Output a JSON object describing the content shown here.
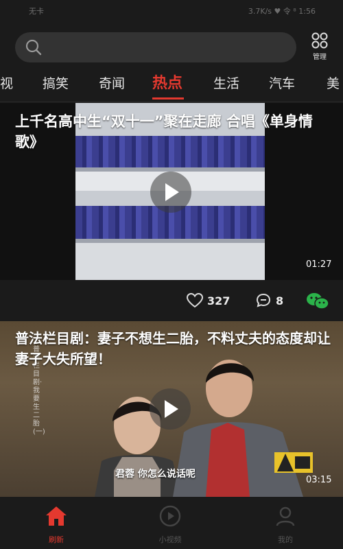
{
  "status_bar": {
    "left": "无卡",
    "right": "3.7K/s ♥ 令 ⁸ 1:56"
  },
  "search": {
    "placeholder": ""
  },
  "manage": {
    "label": "管理"
  },
  "tabs": [
    "视",
    "搞笑",
    "奇闻",
    "热点",
    "生活",
    "汽车",
    "美"
  ],
  "active_tab": "热点",
  "feed": [
    {
      "title": "上千名高中生“双十一”聚在走廊 合唱《单身情歌》",
      "duration": "01:27",
      "likes": "327",
      "comments": "8"
    },
    {
      "title": "普法栏目剧：妻子不想生二胎，不料丈夫的态度却让妻子大失所望！",
      "duration": "03:15",
      "subtitle": "君蓉 你怎么说话呢",
      "side_text": "普法栏目剧·我要生二胎(一)"
    }
  ],
  "bottom_nav": [
    {
      "label": "刷新",
      "icon": "home-icon",
      "active": true
    },
    {
      "label": "小视频",
      "icon": "video-icon",
      "active": false
    },
    {
      "label": "我的",
      "icon": "profile-icon",
      "active": false
    }
  ],
  "colors": {
    "accent": "#e4392f",
    "background": "#1b1b1b",
    "wechat": "#2bb34a"
  }
}
